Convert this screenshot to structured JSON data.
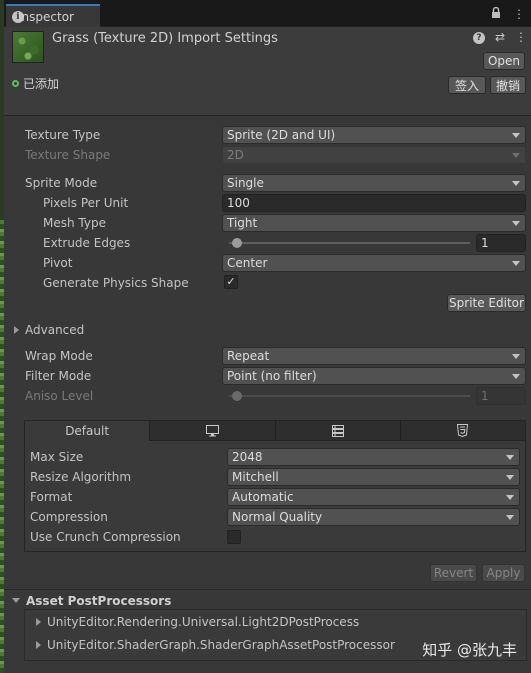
{
  "tab": {
    "label": "Inspector",
    "icon": "info-icon"
  },
  "tab_icons": [
    "lock-icon",
    "more-menu-icon"
  ],
  "header": {
    "title": "Grass (Texture 2D) Import Settings",
    "open_label": "Open",
    "status_text": "已添加",
    "checkin_label": "签入",
    "revert_label": "撤销",
    "icons": [
      "help-icon",
      "preset-icon",
      "more-menu-icon"
    ]
  },
  "settings": {
    "texture_type": {
      "label": "Texture Type",
      "value": "Sprite (2D and UI)"
    },
    "texture_shape": {
      "label": "Texture Shape",
      "value": "2D"
    },
    "sprite_mode": {
      "label": "Sprite Mode",
      "value": "Single"
    },
    "pixels_per_unit": {
      "label": "Pixels Per Unit",
      "value": "100"
    },
    "mesh_type": {
      "label": "Mesh Type",
      "value": "Tight"
    },
    "extrude_edges": {
      "label": "Extrude Edges",
      "value": "1",
      "slider_fraction": 0.0
    },
    "pivot": {
      "label": "Pivot",
      "value": "Center"
    },
    "generate_physics_shape": {
      "label": "Generate Physics Shape",
      "checked": true,
      "check_glyph": "✓"
    },
    "sprite_editor_label": "Sprite Editor",
    "advanced_label": "Advanced",
    "wrap_mode": {
      "label": "Wrap Mode",
      "value": "Repeat"
    },
    "filter_mode": {
      "label": "Filter Mode",
      "value": "Point (no filter)"
    },
    "aniso_level": {
      "label": "Aniso Level",
      "value": "1",
      "slider_fraction": 0.0
    }
  },
  "platform": {
    "tabs": [
      {
        "label": "Default",
        "icon": ""
      },
      {
        "label": "",
        "icon": "monitor-icon"
      },
      {
        "label": "",
        "icon": "server-icon"
      },
      {
        "label": "",
        "icon": "html5-icon"
      }
    ],
    "max_size": {
      "label": "Max Size",
      "value": "2048"
    },
    "resize_algorithm": {
      "label": "Resize Algorithm",
      "value": "Mitchell"
    },
    "format": {
      "label": "Format",
      "value": "Automatic"
    },
    "compression": {
      "label": "Compression",
      "value": "Normal Quality"
    },
    "use_crunch": {
      "label": "Use Crunch Compression",
      "checked": false
    }
  },
  "actions": {
    "revert_label": "Revert",
    "apply_label": "Apply"
  },
  "postprocessors": {
    "title": "Asset PostProcessors",
    "items": [
      "UnityEditor.Rendering.Universal.Light2DPostProcess",
      "UnityEditor.ShaderGraph.ShaderGraphAssetPostProcessor"
    ]
  },
  "watermark": "知乎 @张九丰"
}
